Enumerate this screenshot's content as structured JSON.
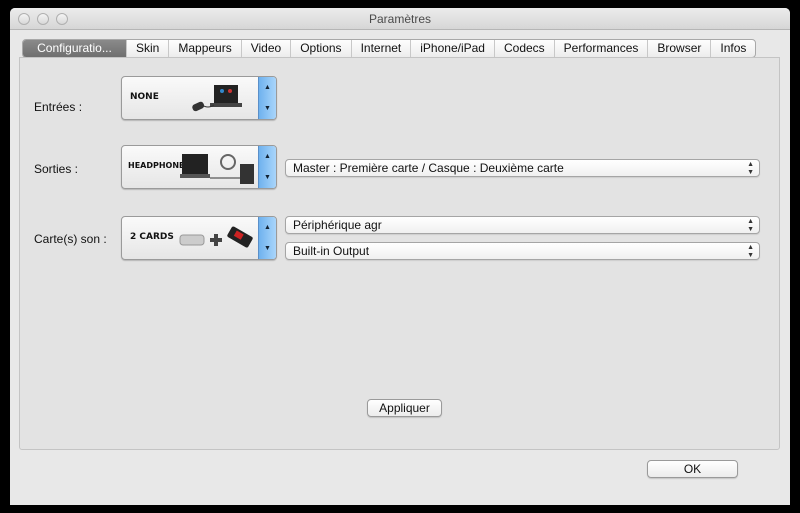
{
  "window": {
    "title": "Paramètres"
  },
  "tabs": [
    "Configuratio...",
    "Skin",
    "Mappeurs",
    "Video",
    "Options",
    "Internet",
    "iPhone/iPad",
    "Codecs",
    "Performances",
    "Browser",
    "Infos"
  ],
  "config": {
    "inputs": {
      "label": "Entrées :",
      "picker": "NONE"
    },
    "outputs": {
      "label": "Sorties :",
      "picker": "HEADPHONES",
      "select": "Master : Première carte / Casque : Deuxième carte"
    },
    "soundcards": {
      "label": "Carte(s) son :",
      "picker": "2 CARDS",
      "select1": "Périphérique agr",
      "select2": "Built-in Output"
    },
    "apply": "Appliquer"
  },
  "ok": "OK",
  "icons": {
    "up": "▲",
    "down": "▼"
  }
}
